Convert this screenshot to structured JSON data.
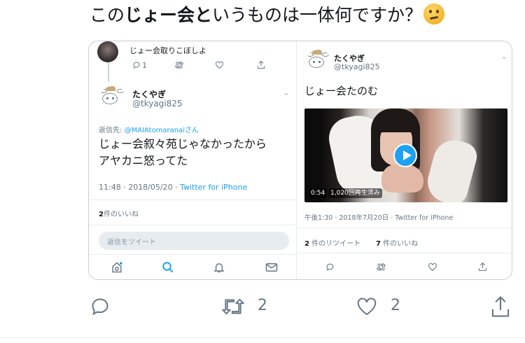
{
  "headline": {
    "prefix": "この",
    "bold1": "じょー会",
    "bold2": "と",
    "suffix": "いうものは一体何ですか？"
  },
  "left_tweet": {
    "parent_text": "じょー会取りこぼしよ",
    "parent_reply_count": "1",
    "author_name": "たくやぎ",
    "author_handle": "@tkyagi825",
    "reply_to_label": "返信先: ",
    "reply_to_handle": "@MAIAtomaranai",
    "reply_to_suffix": "さん",
    "body_line1": "じょー会叙々苑じゃなかったから",
    "body_line2": "アヤカニ怒ってた",
    "timestamp": "11:48 · 2018/05/20 · ",
    "client": "Twitter for iPhone",
    "likes_count": "2",
    "likes_label": "件のいいね",
    "reply_placeholder": "返信をツイート"
  },
  "right_tweet": {
    "author_name": "たくやぎ",
    "author_handle": "@tkyagi825",
    "body": "じょー会たのむ",
    "video_duration": "0:54",
    "video_views": "1,020回再生済み",
    "timestamp": "午後1:30 · 2018年7月20日 · Twitter for iPhone",
    "retweets_count": "2",
    "retweets_label": "件のリツイート",
    "likes_count": "7",
    "likes_label": "件のいいね"
  },
  "main_actions": {
    "retweet_count": "2",
    "like_count": "2"
  },
  "colors": {
    "accent": "#1da1f2",
    "muted": "#657786",
    "border": "#c8ced3"
  },
  "icons": [
    "reply-icon",
    "retweet-icon",
    "like-icon",
    "share-icon",
    "home-icon",
    "search-icon",
    "notifications-icon",
    "messages-icon",
    "play-icon",
    "chevron-down-icon",
    "thinking-emoji-icon"
  ]
}
